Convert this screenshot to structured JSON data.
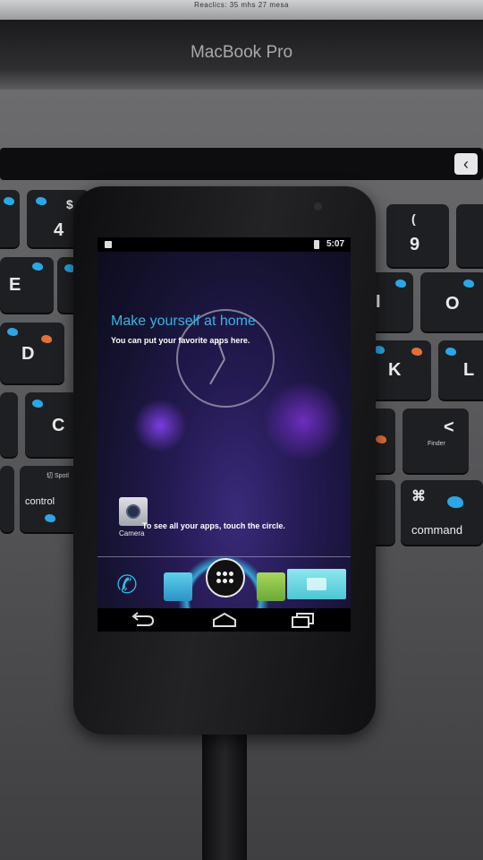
{
  "laptop": {
    "screen_bottom_text": "Reaclics: 35 mhs 27 mesa",
    "brand": "MacBook Pro",
    "touchbar_esc": "‹",
    "keys": {
      "k4": "4",
      "k9": "9",
      "kE": "E",
      "kI": "I",
      "kO": "O",
      "kD": "D",
      "kK": "K",
      "kL": "L",
      "kC": "C",
      "kcmd": "command",
      "kcmd_symbol": "⌘",
      "kcontrol": "control",
      "kcomma": "<",
      "k4_top": "$",
      "k9_top": "("
    }
  },
  "phone": {
    "status_bar": {
      "time": "5:07"
    },
    "cling": {
      "title": "Make yourself at home",
      "subtitle": "You can put your favorite apps here.",
      "all_apps_hint": "To see all your apps, touch the circle."
    },
    "apps": {
      "camera_label": "Camera"
    },
    "icons": {
      "back": "back-icon",
      "home": "home-icon",
      "recent": "recent-apps-icon",
      "phone": "phone-icon",
      "all_apps": "all-apps-icon"
    }
  },
  "colors": {
    "accent": "#34b5e5",
    "wallpaper": "#241a52"
  }
}
